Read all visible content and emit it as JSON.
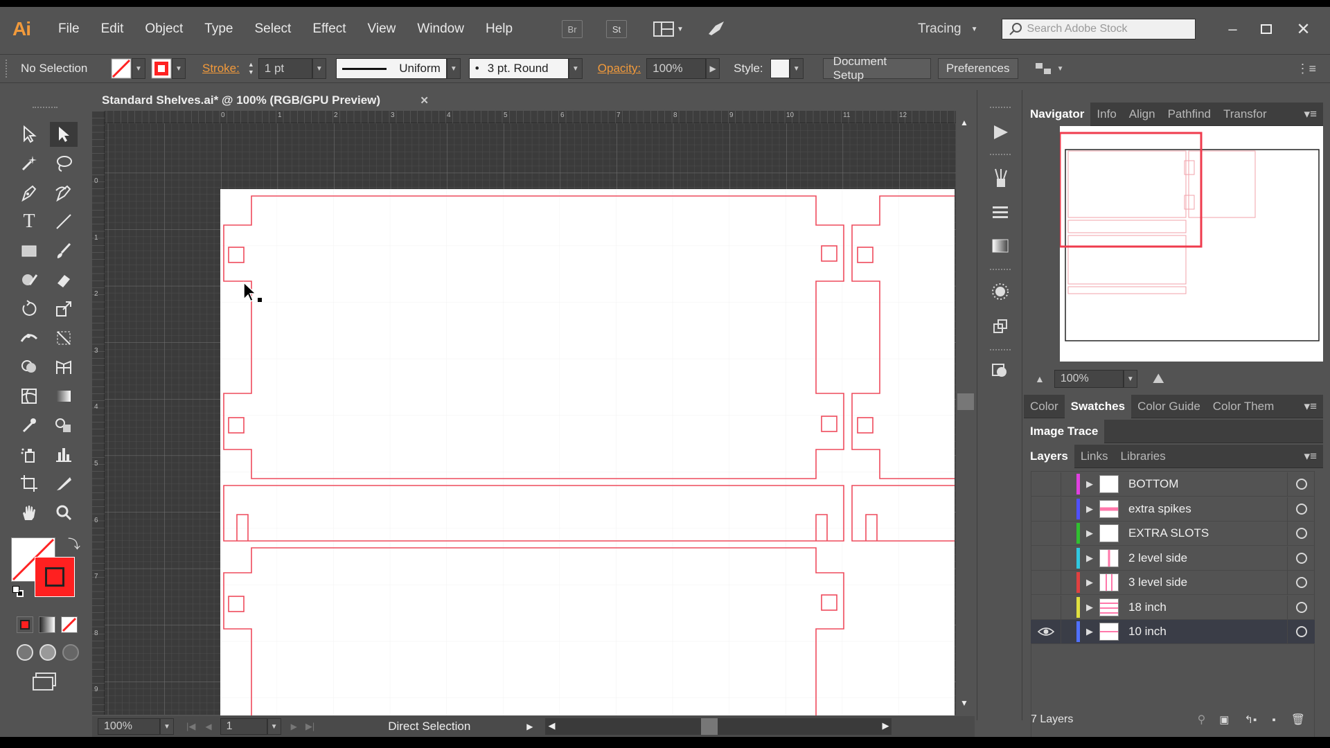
{
  "app": {
    "logo": "Ai"
  },
  "menu": [
    "File",
    "Edit",
    "Object",
    "Type",
    "Select",
    "Effect",
    "View",
    "Window",
    "Help"
  ],
  "appbar": {
    "bridge": "Br",
    "stock": "St",
    "workspace": "Tracing",
    "search_placeholder": "Search Adobe Stock"
  },
  "control": {
    "selection": "No Selection",
    "stroke_label": "Stroke:",
    "stroke_weight": "1 pt",
    "profile": "Uniform",
    "brush": "3 pt. Round",
    "opacity_label": "Opacity:",
    "opacity": "100%",
    "style_label": "Style:",
    "document_setup": "Document Setup",
    "preferences": "Preferences"
  },
  "document": {
    "tab_title": "Standard Shelves.ai* @ 100% (RGB/GPU Preview)",
    "ruler_top": [
      "0",
      "1",
      "2",
      "3",
      "4",
      "5",
      "6",
      "7",
      "8",
      "9",
      "10",
      "11",
      "12"
    ],
    "ruler_left": [
      "0",
      "1",
      "2",
      "3",
      "4",
      "5",
      "6",
      "7",
      "8",
      "9"
    ]
  },
  "status": {
    "zoom": "100%",
    "artboard": "1",
    "tool": "Direct Selection"
  },
  "navigator": {
    "tabs": [
      "Navigator",
      "Info",
      "Align",
      "Pathfind",
      "Transfor"
    ],
    "zoom": "100%"
  },
  "color_tabs": [
    "Color",
    "Swatches",
    "Color Guide",
    "Color Them"
  ],
  "image_trace": "Image Trace",
  "layers_tabs": [
    "Layers",
    "Links",
    "Libraries"
  ],
  "layers": [
    {
      "name": "BOTTOM",
      "color": "#e040e0"
    },
    {
      "name": "extra spikes",
      "color": "#5050ff"
    },
    {
      "name": "EXTRA SLOTS",
      "color": "#30c030"
    },
    {
      "name": "2 level side",
      "color": "#30c8e0"
    },
    {
      "name": "3 level side",
      "color": "#e04040"
    },
    {
      "name": "18 inch",
      "color": "#e0e040"
    },
    {
      "name": "10 inch",
      "color": "#5070ff"
    }
  ],
  "layers_footer": "7 Layers",
  "colors": {
    "accent": "#ff2020",
    "artwork_stroke": "#ee4a5c",
    "ui_bg": "#535353"
  }
}
